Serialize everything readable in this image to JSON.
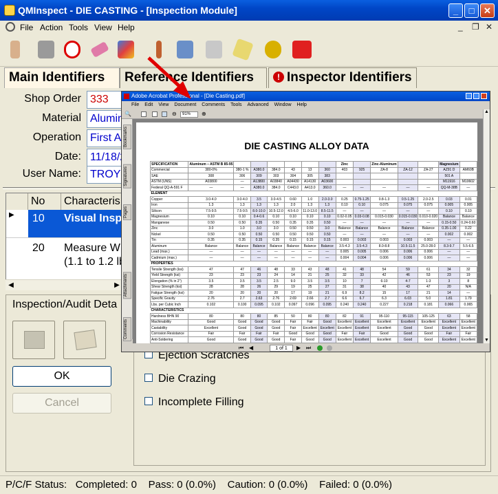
{
  "window": {
    "title": "QMInspect - DIE CASTING - [Inspection Module]",
    "minimize": "_",
    "maximize": "□",
    "close": "✕"
  },
  "menu": {
    "items": [
      "File",
      "Action",
      "Tools",
      "View",
      "Help"
    ],
    "mdi_minimize": "_",
    "mdi_restore": "❐",
    "mdi_close": "✕"
  },
  "tabs": {
    "main": "Main Identifiers",
    "reference": "Reference Identifiers",
    "inspector": "Inspector Identifiers",
    "warn": "!"
  },
  "fields": {
    "shop_order_label": "Shop Order",
    "shop_order_value": "333",
    "material_label": "Material",
    "material_value": "Alumin",
    "operation_label": "Operation",
    "operation_value": "First A",
    "date_label": "Date:",
    "date_value": "11/18/2",
    "user_label": "User Name:",
    "user_value": "TROY"
  },
  "grid": {
    "headers": [
      "No",
      "Characteris"
    ],
    "rows": [
      {
        "no": "10",
        "text": "Visual Inspe",
        "text2": ""
      },
      {
        "no": "20",
        "text": "Measure W",
        "text2": "(1.1 to 1.2 lb"
      }
    ]
  },
  "details": {
    "title": "Inspection/Audit Deta",
    "ok": "OK",
    "cancel": "Cancel",
    "checks": [
      "Ejection Scratches",
      "Die Crazing",
      "Incomplete Filling"
    ]
  },
  "status": {
    "label": "P/C/F Status:",
    "completed": "Completed: 0",
    "pass": "Pass: 0 (0.0%)",
    "caution": "Caution: 0 (0.0%)",
    "failed": "Failed: 0 (0.0%)"
  },
  "acrobat": {
    "title": "Adobe Acrobat Professional - [Die Casting.pdf]",
    "menu": [
      "File",
      "Edit",
      "View",
      "Document",
      "Comments",
      "Tools",
      "Advanced",
      "Window",
      "Help"
    ],
    "zoom": "91%",
    "side_tabs": [
      "Bookmarks",
      "Signatures",
      "Pages",
      "Attachments",
      "Comments"
    ],
    "page_box": "1 of 1",
    "doc_title": "DIE CASTING ALLOY DATA",
    "table": {
      "head": [
        "SPECIFICATION",
        "Aluminum – ASTM B 85-95",
        "",
        "",
        "",
        "",
        "",
        "",
        "Zinc",
        "",
        "Zinc-Aluminum",
        "",
        "",
        "Magnesium",
        ""
      ],
      "rows": [
        [
          "Commercial",
          "380-0%",
          "380-1 %",
          "A380.0",
          "384.0",
          "43",
          "13",
          "360",
          "403",
          "925",
          "ZA-8",
          "ZA-12",
          "ZA-27",
          "AZ91 D",
          "AM60B"
        ],
        [
          "SAE",
          "308",
          "306",
          "309",
          "303",
          "304",
          "305",
          "383",
          "",
          "",
          "",
          "",
          "",
          "501 A",
          ""
        ],
        [
          "ASTM (UNS)",
          "A03800",
          "—",
          "A13800",
          "A03840",
          "A04430",
          "A14130",
          "A03600",
          "",
          "",
          "",
          "",
          "",
          "M11916",
          "M10602"
        ],
        [
          "Federal QQ-A-591 F",
          "—",
          "—",
          "A380.0",
          "384.0",
          "C443.0",
          "A413.0",
          "360.0",
          "—",
          "—",
          "—",
          "—",
          "—",
          "QQ-M-38B",
          "—"
        ],
        [
          "#ELEMENT"
        ],
        [
          "Copper",
          "3.0-4.0",
          "3.0-4.0",
          "3.5",
          "3.0-4.5",
          "0.60",
          "1.0",
          "2.0-3.0",
          "0.25",
          "0.75-1.25",
          "0.8-1.3",
          "0.5-1.25",
          "2.0-2.5",
          "0.03",
          "0.01"
        ],
        [
          "Iron",
          "1.3",
          "1.3",
          "1.3",
          "1.3",
          "2.0",
          "1.3",
          "1.3",
          "0.10",
          "0.10",
          "0.075",
          "0.075",
          "0.075",
          "0.005",
          "0.005"
        ],
        [
          "Silicon",
          "7.5-9.5",
          "7.5-9.5",
          "8.0-10.0",
          "10.5-12.0",
          "4.5-6.0",
          "11.0-13.0",
          "8.5-11.5",
          "—",
          "—",
          "—",
          "—",
          "—",
          "0.10",
          "0.10"
        ],
        [
          "Magnesium",
          "0.10",
          "0.10",
          "0.4-0.6",
          "0.10",
          "0.10",
          "0.10",
          "0.10",
          "0.02-0.05",
          "0.03-0.08",
          "0.015-0.030",
          "0.015-0.030",
          "0.010-0.020",
          "Balance",
          "Balance"
        ],
        [
          "Manganese",
          "0.50",
          "0.50",
          "0.35",
          "0.50",
          "0.35",
          "0.35",
          "0.50",
          "—",
          "—",
          "—",
          "—",
          "—",
          "0.15-0.50",
          "0.24-0.60"
        ],
        [
          "Zinc",
          "3.0",
          "1.0",
          "3.0",
          "3.0",
          "0.50",
          "0.50",
          "3.0",
          "Balance",
          "Balance",
          "Balance",
          "Balance",
          "Balance",
          "0.35-1.00",
          "0.22"
        ],
        [
          "Nickel",
          "0.50",
          "0.50",
          "0.50",
          "0.50",
          "0.50",
          "0.50",
          "0.50",
          "—",
          "—",
          "—",
          "—",
          "—",
          "0.002",
          "0.002"
        ],
        [
          "Tin",
          "0.35",
          "0.35",
          "0.15",
          "0.35",
          "0.15",
          "0.15",
          "0.15",
          "0.003",
          "0.003",
          "0.003",
          "0.003",
          "0.003",
          "—",
          "—"
        ],
        [
          "Aluminum",
          "Balance",
          "Balance",
          "Balance",
          "Balance",
          "Balance",
          "Balance",
          "Balance",
          "3.5-4.3",
          "3.5-4.3",
          "8.0-8.8",
          "10.5-11.5",
          "25.0-28.0",
          "8.3-9.7",
          "5.5-6.5"
        ],
        [
          "Lead (max.)",
          "—",
          "—",
          "—",
          "—",
          "—",
          "—",
          "—",
          "0.005",
          "0.005",
          "0.006",
          "0.006",
          "0.006",
          "—",
          "—"
        ],
        [
          "Cadmium (max.)",
          "—",
          "—",
          "—",
          "—",
          "—",
          "—",
          "—",
          "0.004",
          "0.004",
          "0.006",
          "0.006",
          "0.006",
          "—",
          "—"
        ],
        [
          "#PROPERTIES"
        ],
        [
          "Tensile Strength (ksi)",
          "47",
          "47",
          "46",
          "48",
          "33",
          "43",
          "48",
          "41",
          "48",
          "54",
          "59",
          "61",
          "34",
          "32"
        ],
        [
          "Yield Strength (ksi)",
          "23",
          "23",
          "23",
          "24",
          "14",
          "21",
          "25",
          "32",
          "33",
          "42",
          "46",
          "53",
          "23",
          "19"
        ],
        [
          "Elongation (% in 2\")",
          "3.5",
          "3.5",
          "3.5",
          "2.5",
          "9.0",
          "3.5",
          "3.5",
          "10",
          "7",
          "6-10",
          "4-7",
          "1-3",
          "3",
          "8"
        ],
        [
          "Shear Strength (ksi)",
          "28",
          "28",
          "26",
          "29",
          "19",
          "25",
          "27",
          "31",
          "38",
          "40",
          "43",
          "47",
          "20",
          "N/A"
        ],
        [
          "Fatigue Strength (ksi)",
          "20",
          "20",
          "20",
          "20",
          "17",
          "19",
          "21",
          "6.9",
          "8.2",
          "15",
          "17",
          "21",
          "14",
          "—"
        ],
        [
          "Specific Gravity",
          "2.76",
          "2.7",
          "2.63",
          "2.76",
          "2.69",
          "2.66",
          "2.7",
          "6.6",
          "6.7",
          "6.3",
          "6.03",
          "5.0",
          "1.81",
          "1.79"
        ],
        [
          "Lbs. per Cubic Inch",
          "0.102",
          "0.100",
          "0.095",
          "0.102",
          "0.097",
          "0.096",
          "0.095",
          "0.240",
          "0.240",
          "0.227",
          "0.218",
          "0.181",
          "0.066",
          "0.065"
        ],
        [
          "#CHARACTERISTICS"
        ],
        [
          "Hardness BHN 90",
          "80",
          "80",
          "80",
          "85",
          "50",
          "80",
          "80",
          "82",
          "91",
          "95-110",
          "95-115",
          "105-125",
          "63",
          "58"
        ],
        [
          "Machinability",
          "Good",
          "Good",
          "Good",
          "Good",
          "Fair",
          "Fair",
          "Good",
          "Excellent",
          "Excellent",
          "Excellent",
          "Excellent",
          "Excellent",
          "Excellent",
          "Excellent"
        ],
        [
          "Castability",
          "Excellent",
          "Good",
          "Good",
          "Good",
          "Fair",
          "Excellent",
          "Excellent",
          "Excellent",
          "Excellent",
          "Excellent",
          "Good",
          "Good",
          "Excellent",
          "Excellent"
        ],
        [
          "Corrosion Resistance",
          "Fair",
          "Fair",
          "Fair",
          "Fair",
          "Good",
          "Good",
          "Good",
          "Fair",
          "Fair",
          "Good",
          "Good",
          "Good",
          "Fair",
          "Fair"
        ],
        [
          "Anti-Soldering",
          "Good",
          "Good",
          "Good",
          "Good",
          "Fair",
          "Good",
          "Good",
          "Excellent",
          "Excellent",
          "Excellent",
          "Good",
          "Good",
          "Excellent",
          "Excellent"
        ]
      ]
    }
  },
  "colors": {
    "title_bar": "#0a5fe0",
    "link_blue": "#0000cc",
    "shop_red": "#cc0000",
    "selected_row": "#0a58d6",
    "arrow_red": "#e00000"
  }
}
